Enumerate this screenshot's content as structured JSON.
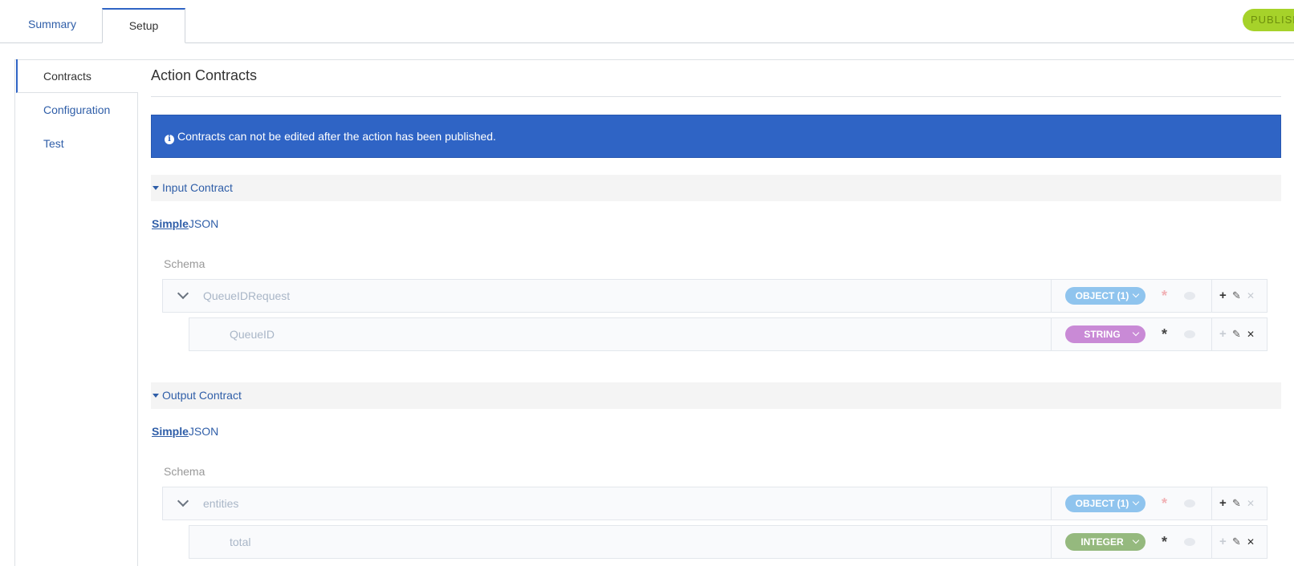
{
  "tabs": {
    "summary": "Summary",
    "setup": "Setup"
  },
  "publish_label": "PUBLISH",
  "side_nav": {
    "contracts": "Contracts",
    "configuration": "Configuration",
    "test": "Test"
  },
  "page_title": "Action Contracts",
  "banner_text": "Contracts can not be edited after the action has been published.",
  "input_contract": {
    "header": "Input Contract",
    "mode_simple": "Simple",
    "mode_json": "JSON",
    "schema_label": "Schema",
    "rows": [
      {
        "name": "QueueIDRequest",
        "type": "OBJECT (1)",
        "color": "#8fc4ee"
      },
      {
        "name": "QueueID",
        "type": "STRING",
        "color": "#c98ad6"
      }
    ]
  },
  "output_contract": {
    "header": "Output Contract",
    "mode_simple": "Simple",
    "mode_json": "JSON",
    "schema_label": "Schema",
    "rows": [
      {
        "name": "entities",
        "type": "OBJECT (1)",
        "color": "#8fc4ee"
      },
      {
        "name": "total",
        "type": "INTEGER",
        "color": "#95b97e"
      }
    ]
  },
  "icons": {
    "required": "*",
    "add": "+",
    "edit": "✎",
    "delete": "✕",
    "info": "i"
  },
  "colors": {
    "accent": "#2f64c5",
    "publish": "#a6d22a",
    "required_red": "#f1b1b5"
  }
}
